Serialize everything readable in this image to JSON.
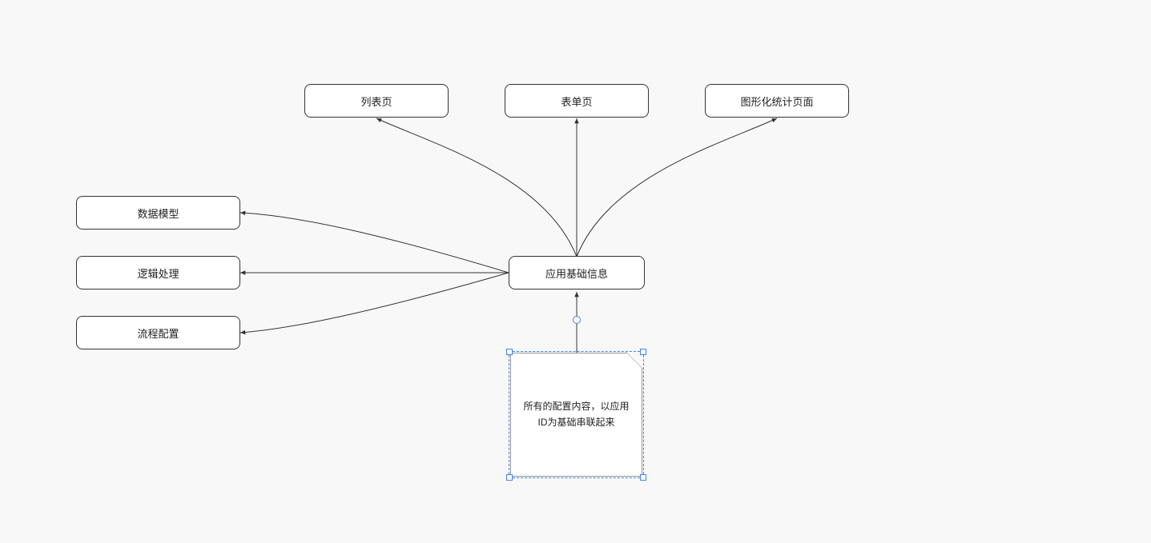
{
  "nodes": {
    "list_page": {
      "label": "列表页"
    },
    "form_page": {
      "label": "表单页"
    },
    "chart_page": {
      "label": "图形化统计页面"
    },
    "data_model": {
      "label": "数据模型"
    },
    "logic_process": {
      "label": "逻辑处理"
    },
    "flow_config": {
      "label": "流程配置"
    },
    "app_base_info": {
      "label": "应用基础信息"
    }
  },
  "note": {
    "text": "所有的配置内容，以应用ID为基础串联起来"
  },
  "colors": {
    "selection": "#3b82f6",
    "stroke": "#333333",
    "bg": "#f8f8f8"
  }
}
